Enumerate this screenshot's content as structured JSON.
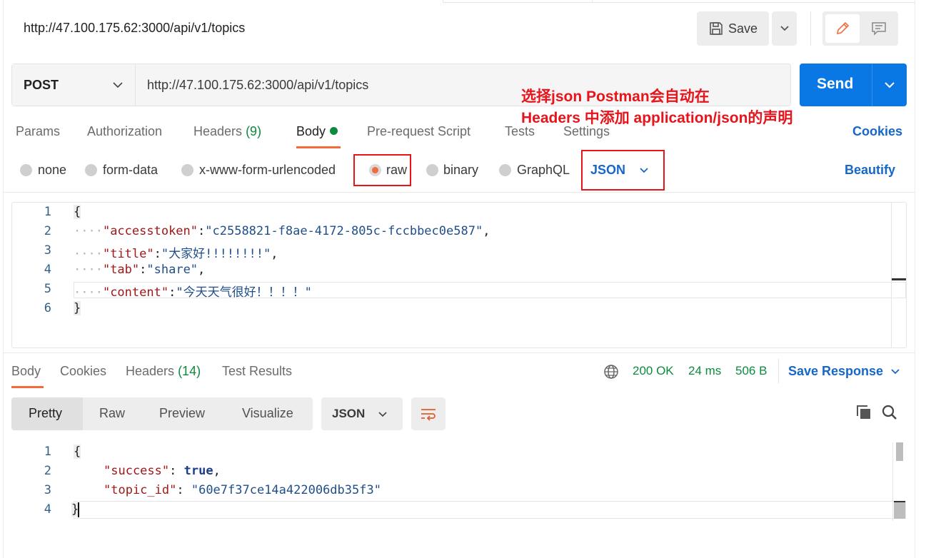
{
  "request": {
    "title": "http://47.100.175.62:3000/api/v1/topics",
    "save_label": "Save",
    "method": "POST",
    "url": "http://47.100.175.62:3000/api/v1/topics",
    "send_label": "Send"
  },
  "annotation": {
    "line1": "选择json Postman会自动在",
    "line2": "Headers 中添加 application/json的声明"
  },
  "request_tabs": {
    "params": "Params",
    "authorization": "Authorization",
    "headers": "Headers",
    "headers_count": "(9)",
    "body": "Body",
    "prerequest": "Pre-request Script",
    "tests": "Tests",
    "settings": "Settings",
    "cookies": "Cookies"
  },
  "body_types": {
    "none": "none",
    "form_data": "form-data",
    "urlencoded": "x-www-form-urlencoded",
    "raw": "raw",
    "binary": "binary",
    "graphql": "GraphQL",
    "format": "JSON",
    "beautify": "Beautify"
  },
  "request_body": {
    "line_numbers": [
      "1",
      "2",
      "3",
      "4",
      "5",
      "6"
    ],
    "open_brace": "{",
    "close_brace": "}",
    "indent": "····",
    "lines": [
      {
        "key": "\"accesstoken\"",
        "value": "\"c2558821-f8ae-4172-805c-fccbbec0e587\"",
        "tail": ","
      },
      {
        "key": "\"title\"",
        "value": "\"大家好!!!!!!!!\"",
        "tail": ","
      },
      {
        "key": "\"tab\"",
        "value": "\"share\"",
        "tail": ","
      },
      {
        "key": "\"content\"",
        "value": "\"今天天气很好！！！！\"",
        "tail": ""
      }
    ]
  },
  "response": {
    "tabs": {
      "body": "Body",
      "cookies": "Cookies",
      "headers": "Headers",
      "headers_count": "(14)",
      "test_results": "Test Results"
    },
    "status": "200 OK",
    "time": "24 ms",
    "size": "506 B",
    "save_response": "Save Response",
    "views": {
      "pretty": "Pretty",
      "raw": "Raw",
      "preview": "Preview",
      "visualize": "Visualize"
    },
    "format": "JSON",
    "line_numbers": [
      "1",
      "2",
      "3",
      "4"
    ],
    "open_brace": "{",
    "close_brace": "}",
    "lines": [
      {
        "key": "\"success\"",
        "value": "true",
        "tail": ","
      },
      {
        "key": "\"topic_id\"",
        "value": "\"60e7f37ce14a422006db35f3\"",
        "tail": ""
      }
    ]
  },
  "colors": {
    "send_blue": "#0a78e4",
    "link_blue": "#1667c7",
    "active_orange": "#f26b3a",
    "status_green": "#0d8a3e",
    "annotation_red": "#e8141b"
  },
  "icons": [
    "save-icon",
    "chevron-down-icon",
    "pencil-icon",
    "comment-icon",
    "globe-icon",
    "copy-icon",
    "search-icon",
    "wrap-lines-icon"
  ]
}
